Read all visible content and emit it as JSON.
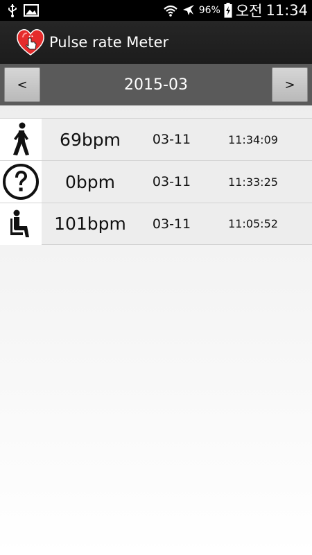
{
  "status_bar": {
    "battery_percent": "96%",
    "ampm": "오전",
    "clock": "11:34",
    "icons": [
      "usb-icon",
      "image-icon",
      "wifi-icon",
      "airplane-icon",
      "battery-charging-icon"
    ]
  },
  "app": {
    "title": "Pulse rate Meter",
    "logo": "heart-touch-logo",
    "accent_color": "#e52b2b"
  },
  "month_nav": {
    "prev_label": "<",
    "month": "2015-03",
    "next_label": ">"
  },
  "records": [
    {
      "activity_icon": "walking-person-icon",
      "bpm": "69bpm",
      "date": "03-11",
      "time": "11:34:09"
    },
    {
      "activity_icon": "question-mark-icon",
      "bpm": "0bpm",
      "date": "03-11",
      "time": "11:33:25"
    },
    {
      "activity_icon": "sitting-person-icon",
      "bpm": "101bpm",
      "date": "03-11",
      "time": "11:05:52"
    }
  ]
}
